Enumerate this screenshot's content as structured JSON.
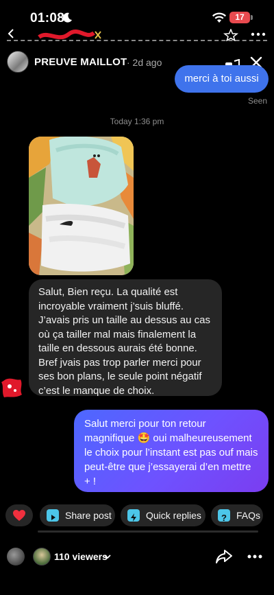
{
  "status_bar": {
    "time": "01:08",
    "battery": "17"
  },
  "header": {
    "name": "PREUVE MAILLOT",
    "time": "· 2d ago"
  },
  "messages": {
    "sent_top": "merci à toi aussi",
    "seen": "Seen",
    "timestamp": "Today 1:36 pm",
    "received": "Salut, Bien reçu. La qualité est incroyable vraiment j’suis bluffé. J’avais pris un taille au dessus au cas où ça tailler mal mais finalement la taille en dessous aurais été bonne. Bref jvais pas trop parler merci pour ses bon plans, le seule point négatif c’est le manque de choix.",
    "sent_main_before": "Salut merci pour ton retour magnifique",
    "sent_main_emoji": "🤩",
    "sent_main_after": "oui malheureusement le choix pour l’instant est pas ouf mais peut-être que j’essayerai d’en mettre + !"
  },
  "actions": {
    "share": "Share post",
    "quick": "Quick replies",
    "faqs": "FAQs"
  },
  "footer": {
    "viewers": "110 viewers"
  },
  "colors": {
    "sent_bubble": "#3f73ec",
    "gradient_start": "#4d68ff",
    "gradient_end": "#7b3df0",
    "chip_icon": "#4cc6e9",
    "heart": "#f0303e"
  }
}
